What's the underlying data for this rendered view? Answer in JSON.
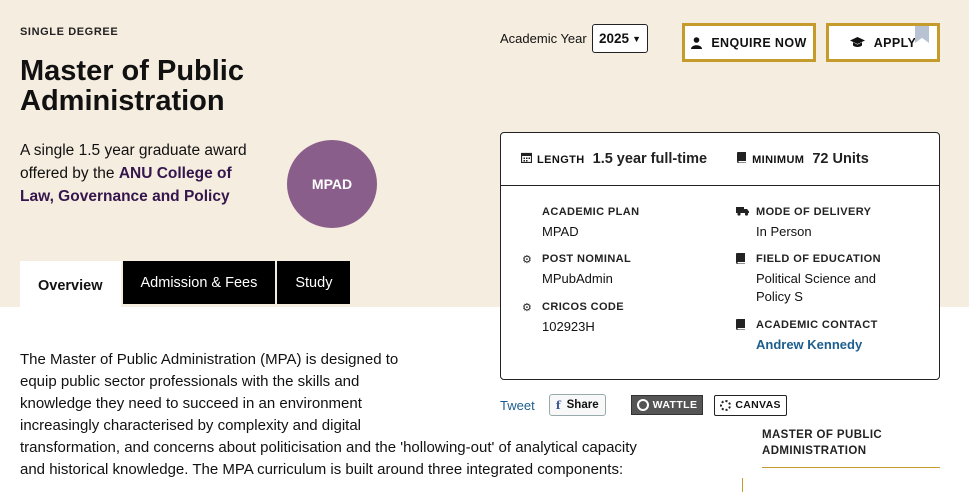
{
  "header": {
    "eyebrow": "SINGLE DEGREE",
    "title": "Master of Public Administration",
    "summary_prefix": "A single 1.5 year graduate award offered by the ",
    "summary_college": "ANU College of Law, Governance and Policy",
    "program_code": "MPAD"
  },
  "academic_year": {
    "label": "Academic Year",
    "value": "2025"
  },
  "actions": {
    "enquire_label": "ENQUIRE NOW",
    "apply_label": "APPLY"
  },
  "tabs": [
    {
      "label": "Overview",
      "active": true
    },
    {
      "label": "Admission & Fees",
      "active": false
    },
    {
      "label": "Study",
      "active": false
    }
  ],
  "info": {
    "length_label": "LENGTH",
    "length_value": "1.5 year full-time",
    "minimum_label": "MINIMUM",
    "minimum_value": "72 Units",
    "fields": [
      {
        "label": "ACADEMIC PLAN",
        "value": "MPAD",
        "icon": "none"
      },
      {
        "label": "MODE OF DELIVERY",
        "value": "In Person",
        "icon": "truck-icon"
      },
      {
        "label": "POST NOMINAL",
        "value": "MPubAdmin",
        "icon": "gear-icon"
      },
      {
        "label": "FIELD OF EDUCATION",
        "value": "Political Science and Policy S",
        "icon": "book-icon"
      },
      {
        "label": "CRICOS CODE",
        "value": "102923H",
        "icon": "gear-icon"
      },
      {
        "label": "ACADEMIC CONTACT",
        "value": "Andrew Kennedy",
        "icon": "book-icon"
      }
    ]
  },
  "share": {
    "tweet": "Tweet",
    "fb_share": "Share",
    "wattle": "WATTLE",
    "canvas": "CANVAS"
  },
  "sidebar": {
    "heading": "MASTER OF PUBLIC ADMINISTRATION"
  },
  "body": {
    "lines": [
      "The Master of Public Administration (MPA) is designed to",
      "equip public sector professionals with the skills and",
      "knowledge they need to succeed in an environment",
      "increasingly characterised by complexity and digital",
      "transformation, and concerns about politicisation and the 'hollowing-out' of analytical capacity",
      "and historical knowledge. The MPA curriculum is built around three integrated components:"
    ]
  },
  "colors": {
    "hero_bg": "#f5eddf",
    "accent_gold": "#c59b2b",
    "circle_purple": "#8a5e8a",
    "link_blue": "#1c5e8e"
  }
}
